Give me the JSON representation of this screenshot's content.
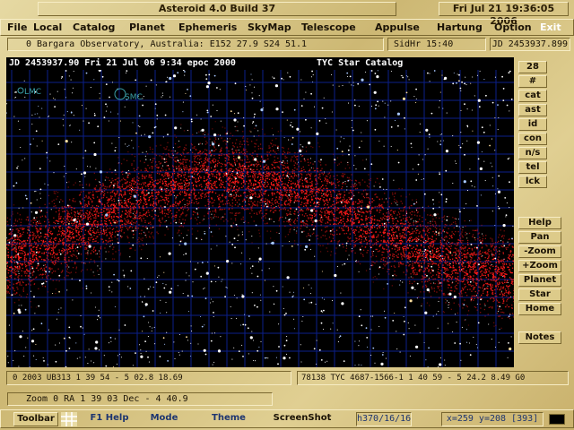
{
  "title_bar": {
    "app_title": "Asteroid 4.0  Build 37",
    "clock": "Fri Jul 21 19:36:05 2006"
  },
  "menu": {
    "items": [
      "File",
      "Local",
      "Catalog",
      "Planet",
      "Ephemeris",
      "SkyMap",
      "Telescope",
      "Appulse",
      "Hartung",
      "Option"
    ],
    "exit": "Exit"
  },
  "status": {
    "observatory": "0 Bargara Observatory, Australia: E152 27.9   S24 51.1",
    "sidhr": "SidHr 15:40",
    "jd": "JD 2453937.899"
  },
  "map": {
    "header_left": "JD 2453937.90  Fri 21 Jul 06  9:34 epoc 2000",
    "header_right": "TYC Star Catalog",
    "labels": {
      "lmc": "LMC",
      "smc": "SMC"
    },
    "colors": {
      "background": "#000000",
      "grid": "#0b1f8a",
      "milky_way": "#ff1a1a",
      "stars": "#ffffff"
    }
  },
  "side_buttons": {
    "top": [
      "28",
      "#",
      "cat",
      "ast",
      "id",
      "con",
      "n/s",
      "tel",
      "lck"
    ],
    "bottom": [
      "Help",
      "Pan",
      "-Zoom",
      "+Zoom",
      "Planet",
      "Star",
      "Home"
    ],
    "notes": "Notes"
  },
  "info": {
    "left": "0  2003 UB313      1 39 54   - 5 02.8    18.69",
    "right": "78138  TYC 4687-1566-1   1 40 59   - 5 24.2    8.49  G0"
  },
  "zoom_line": "Zoom 0  RA  1 39 03  Dec - 4 40.9",
  "toolbar": {
    "toolbar": "Toolbar",
    "f1help": "F1 Help",
    "mode": "Mode",
    "theme": "Theme",
    "screenshot": "ScreenShot",
    "hjd": "h370/16/16",
    "coords": "x=259 y=208 [393]"
  }
}
